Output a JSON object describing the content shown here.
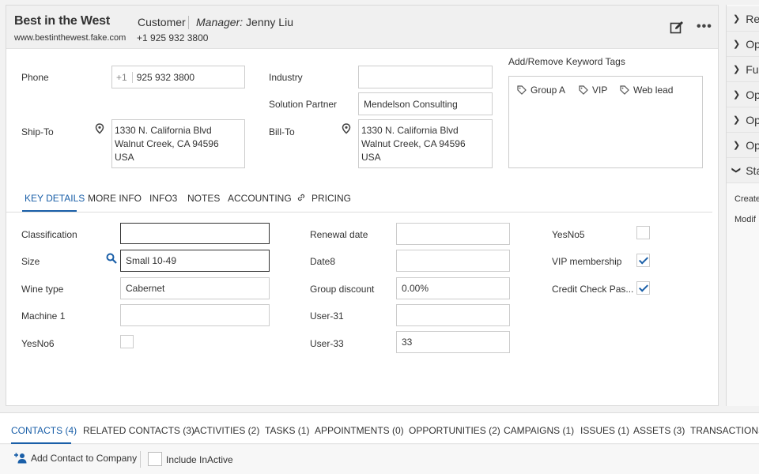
{
  "header": {
    "company_name": "Best in the West",
    "type": "Customer",
    "manager_label": "Manager:",
    "manager_name": "Jenny Liu",
    "website": "www.bestinthewest.fake.com",
    "phone": "+1 925 932 3800"
  },
  "contact": {
    "phone_label": "Phone",
    "phone_prefix": "+1",
    "phone_value": "925 932 3800",
    "industry_label": "Industry",
    "industry_value": "",
    "partner_label": "Solution Partner",
    "partner_value": "Mendelson Consulting",
    "shipto_label": "Ship-To",
    "shipto_lines": [
      "1330 N. California Blvd",
      "Walnut Creek, CA 94596",
      "USA"
    ],
    "billto_label": "Bill-To",
    "billto_lines": [
      "1330 N. California Blvd",
      "Walnut Creek, CA 94596",
      "USA"
    ]
  },
  "tags": {
    "label": "Add/Remove Keyword Tags",
    "items": [
      "Group A",
      "VIP",
      "Web lead"
    ]
  },
  "tabs": [
    "KEY DETAILS",
    "MORE INFO",
    "INFO3",
    "NOTES",
    "ACCOUNTING",
    "PRICING"
  ],
  "key_details": {
    "classification_label": "Classification",
    "classification_value": "",
    "size_label": "Size",
    "size_value": "Small 10-49",
    "wine_label": "Wine type",
    "wine_value": "Cabernet",
    "machine_label": "Machine 1",
    "machine_value": "",
    "yesno6_label": "YesNo6",
    "renewal_label": "Renewal date",
    "renewal_value": "",
    "date8_label": "Date8",
    "date8_value": "",
    "group_discount_label": "Group discount",
    "group_discount_value": "0.00%",
    "user31_label": "User-31",
    "user31_value": "",
    "user33_label": "User-33",
    "user33_value": "33",
    "yesno5_label": "YesNo5",
    "vip_label": "VIP membership",
    "credit_label": "Credit Check Pas..."
  },
  "side_panel": {
    "items": [
      "Re",
      "Op",
      "Fu",
      "Op",
      "Op",
      "Op",
      "Sta"
    ],
    "text1": "Create",
    "text2": "Modif"
  },
  "bottom_tabs": [
    "CONTACTS (4)",
    "RELATED CONTACTS (3)",
    "ACTIVITIES (2)",
    "TASKS (1)",
    "APPOINTMENTS (0)",
    "OPPORTUNITIES (2)",
    "CAMPAIGNS (1)",
    "ISSUES (1)",
    "ASSETS (3)",
    "TRANSACTIONS"
  ],
  "bottom_bar": {
    "add_contact": "Add Contact to Company",
    "include_inactive": "Include InActive"
  },
  "colors": {
    "accent": "#1a5fa8",
    "header_bg": "#f0f0f0"
  },
  "icons": [
    "edit-icon",
    "more-icon",
    "location-pin-icon",
    "tag-icon",
    "search-icon",
    "link-icon",
    "add-user-icon",
    "chevron-right-icon",
    "chevron-down-icon"
  ]
}
